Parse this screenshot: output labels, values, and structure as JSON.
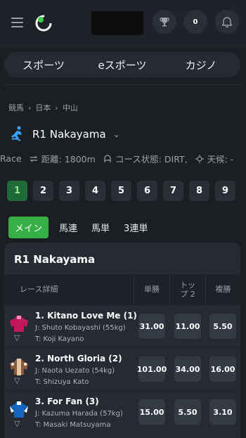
{
  "header": {
    "counter": "0",
    "icons": [
      "menu-icon",
      "logo-icon",
      "trophy-icon",
      "bell-icon"
    ]
  },
  "categories": [
    "スポーツ",
    "eスポーツ",
    "カジノ"
  ],
  "breadcrumb": [
    "競馬",
    "日本",
    "中山"
  ],
  "race": {
    "title": "R1 Nakayama",
    "info": {
      "race_label": "Race",
      "distance": "距離: 1800m",
      "course": "コース状態: DIRT,",
      "weather": "天候: -"
    }
  },
  "race_numbers": [
    "1",
    "2",
    "3",
    "4",
    "5",
    "6",
    "7",
    "8",
    "9"
  ],
  "active_race": "1",
  "bet_tabs": [
    "メイン",
    "馬連",
    "馬単",
    "3連単"
  ],
  "card": {
    "title": "R1 Nakayama",
    "columns": {
      "details": "レース詳細",
      "win": "単勝",
      "top2": "トップ 2",
      "place": "複勝"
    },
    "runners": [
      {
        "name": "1. Kitano Love Me (1)",
        "jockey": "J: Shuto Kobayashi (55kg)",
        "trainer": "T: Koji Kayano",
        "win": "31.00",
        "top2": "11.00",
        "place": "5.50",
        "silk_color": "#c2185b"
      },
      {
        "name": "2. North Gloria (2)",
        "jockey": "J: Naota Uezato (54kg)",
        "trainer": "T: Shizuya Kato",
        "win": "101.00",
        "top2": "34.00",
        "place": "16.00",
        "silk_color": "#8d5a3b"
      },
      {
        "name": "3. For Fan (3)",
        "jockey": "J: Kazuma Harada (57kg)",
        "trainer": "T: Masaki Matsuyama",
        "win": "15.00",
        "top2": "5.50",
        "place": "3.10",
        "silk_color": "#1565c0"
      }
    ]
  },
  "colors": {
    "accent": "#38b048",
    "background": "#1b1f24",
    "card": "#262b33"
  }
}
